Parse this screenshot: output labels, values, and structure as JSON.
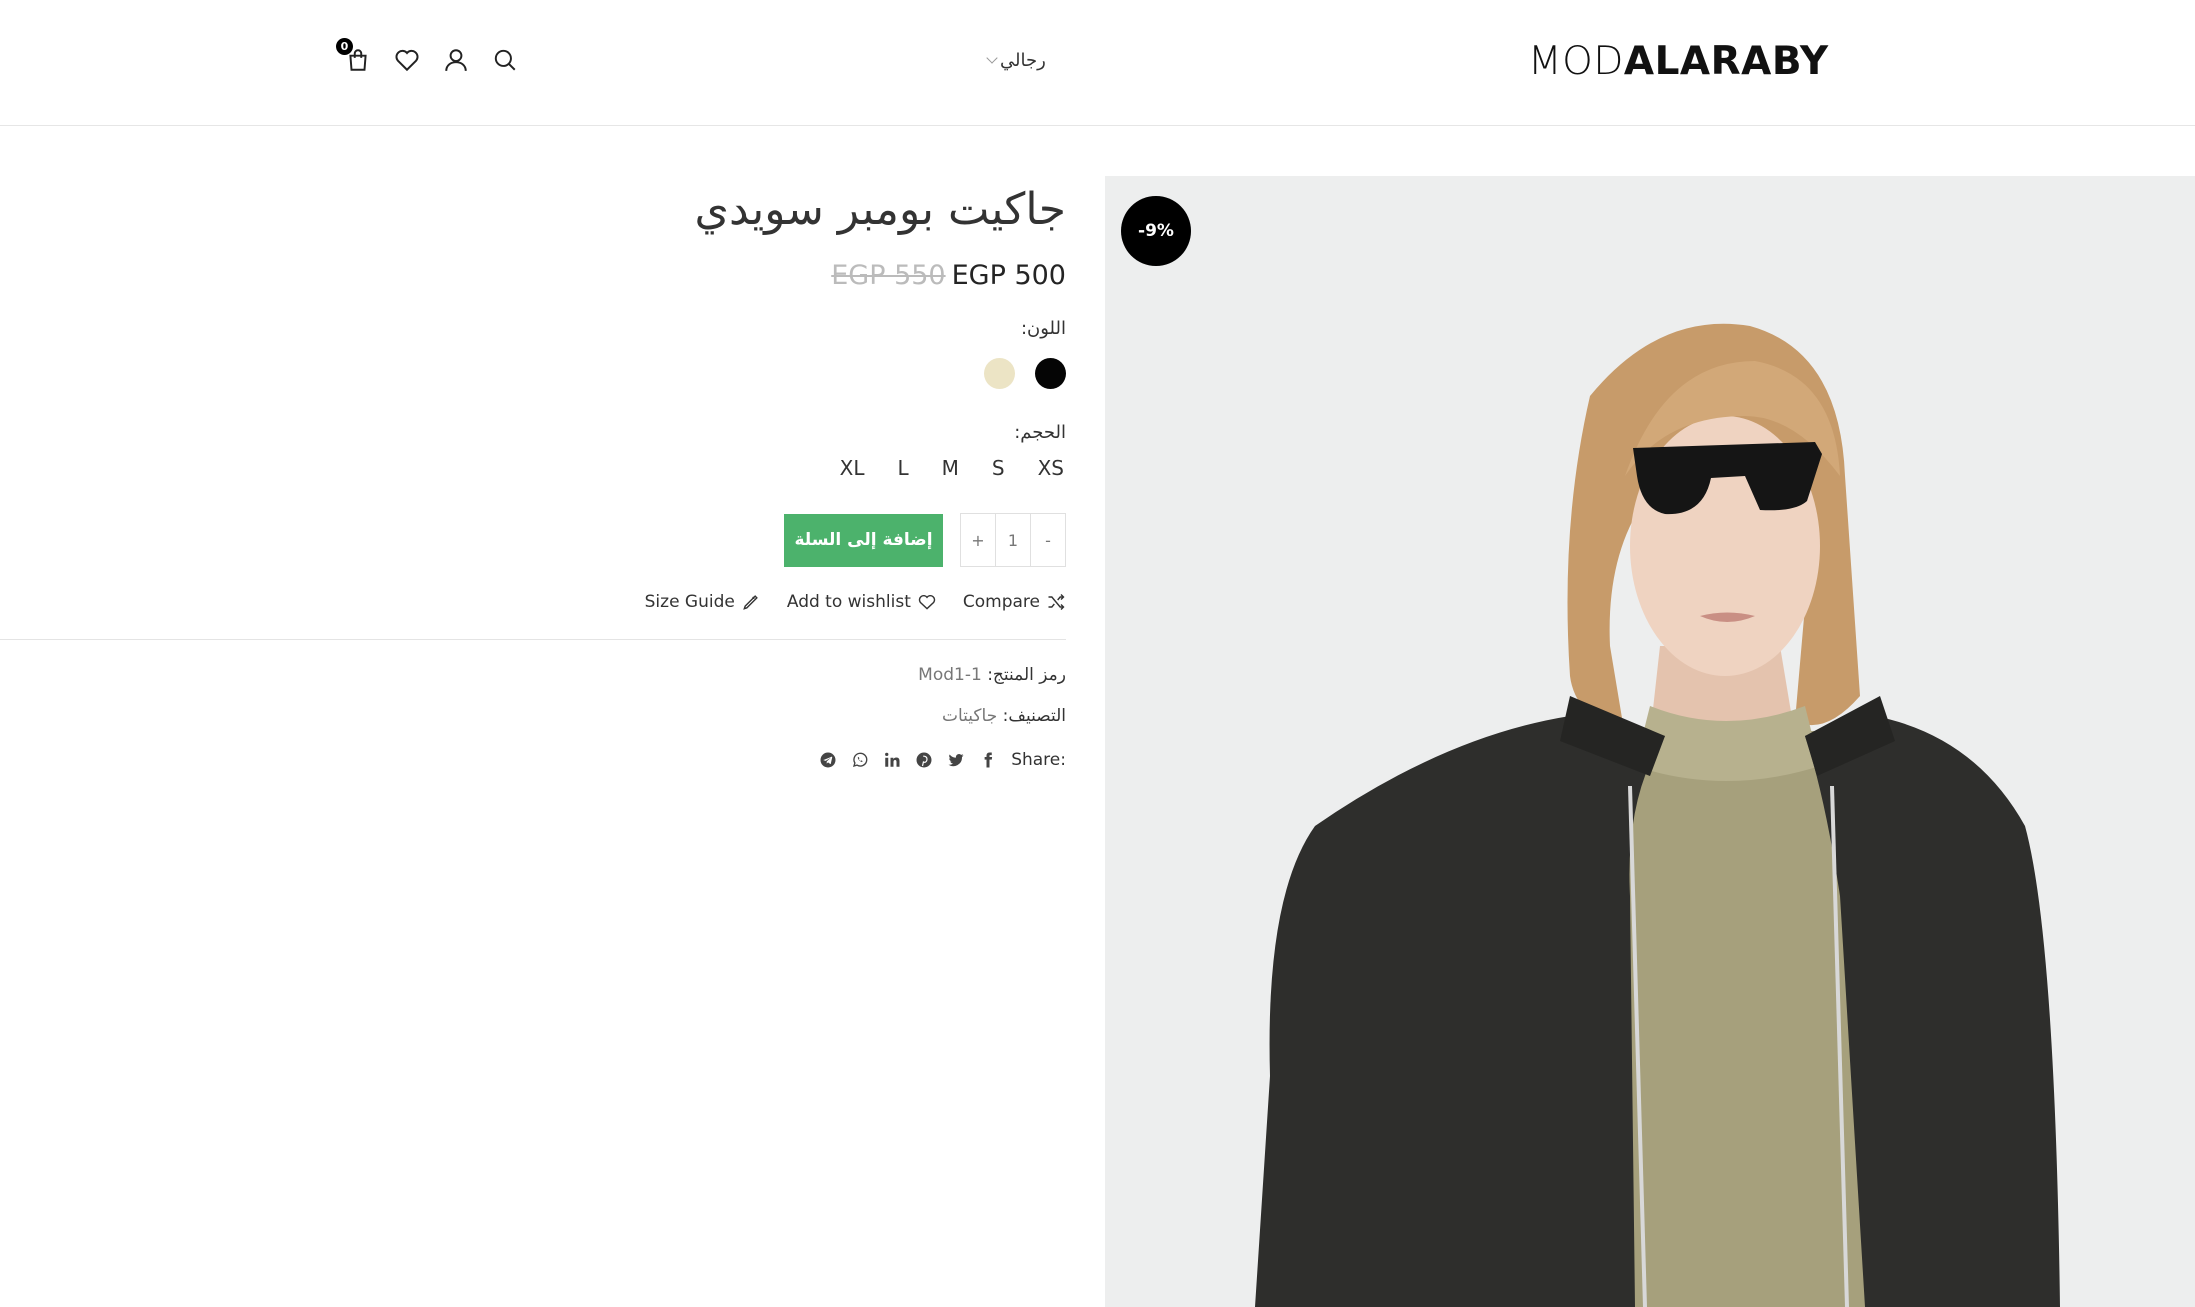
{
  "header": {
    "logo_light": "MOD",
    "logo_bold": "ALARABY",
    "nav_item": "رجالي",
    "cart_count": "0",
    "icons": [
      "search-icon",
      "user-icon",
      "heart-icon",
      "shopping-bag-icon"
    ]
  },
  "product": {
    "sale_badge": "-9%",
    "title": "جاكيت بومبر سويدي",
    "price_old": "EGP 550",
    "price_new": "EGP 500",
    "color_label": "اللون:",
    "colors": [
      {
        "name": "black",
        "hex": "#050505"
      },
      {
        "name": "beige",
        "hex": "#ece4c5"
      }
    ],
    "size_label": "الحجم:",
    "sizes": [
      "XS",
      "S",
      "M",
      "L",
      "XL"
    ],
    "quantity": {
      "minus": "-",
      "value": "1",
      "plus": "+"
    },
    "add_to_cart": "إضافة إلى السلة",
    "actions": {
      "compare": "Compare",
      "wishlist": "Add to wishlist",
      "size_guide": "Size Guide"
    },
    "sku_label": "رمز المنتج:",
    "sku_value": "Mod1-1",
    "category_label": "التصنيف:",
    "category_value": "جاكيتات",
    "share_label": "Share:",
    "share_icons": [
      "facebook-icon",
      "twitter-icon",
      "pinterest-icon",
      "linkedin-icon",
      "whatsapp-icon",
      "telegram-icon"
    ]
  },
  "colors": {
    "accent_green": "#4cb26c",
    "badge_black": "#000000",
    "image_bg": "#edeeee"
  }
}
